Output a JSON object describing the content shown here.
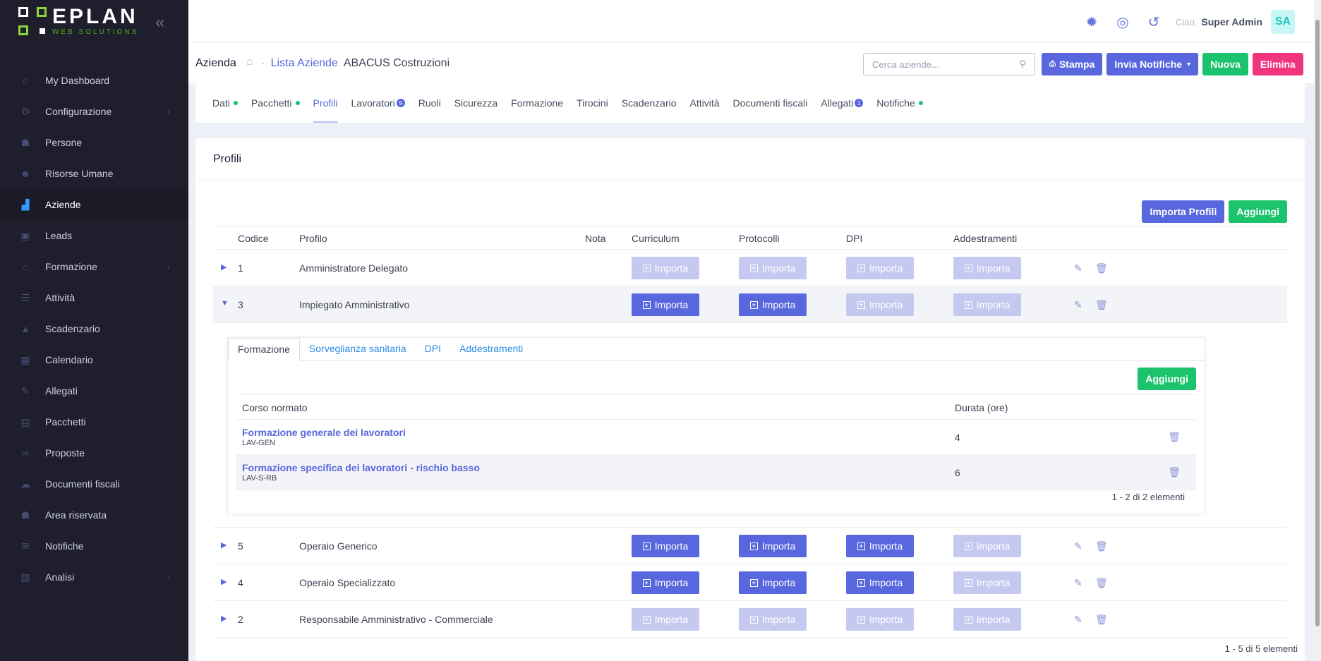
{
  "brand": {
    "name": "EPLAN",
    "tagline": "WEB SOLUTIONS"
  },
  "sidebar": {
    "items": [
      {
        "label": "My Dashboard",
        "icon": "home-icon"
      },
      {
        "label": "Configurazione",
        "icon": "gear-icon",
        "submenu": true
      },
      {
        "label": "Persone",
        "icon": "users-icon"
      },
      {
        "label": "Risorse Umane",
        "icon": "user-icon"
      },
      {
        "label": "Aziende",
        "icon": "factory-icon",
        "active": true
      },
      {
        "label": "Leads",
        "icon": "contact-book-icon"
      },
      {
        "label": "Formazione",
        "icon": "graduation-cap-icon",
        "submenu": true
      },
      {
        "label": "Attività",
        "icon": "list-icon"
      },
      {
        "label": "Scadenzario",
        "icon": "warning-icon"
      },
      {
        "label": "Calendario",
        "icon": "calendar-icon"
      },
      {
        "label": "Allegati",
        "icon": "paperclip-icon"
      },
      {
        "label": "Pacchetti",
        "icon": "package-icon"
      },
      {
        "label": "Proposte",
        "icon": "handshake-icon"
      },
      {
        "label": "Documenti fiscali",
        "icon": "cloud-icon"
      },
      {
        "label": "Area riservata",
        "icon": "user-lock-icon"
      },
      {
        "label": "Notifiche",
        "icon": "envelope-icon"
      },
      {
        "label": "Analisi",
        "icon": "chart-icon",
        "submenu": true
      }
    ]
  },
  "topbar": {
    "greeting": "Ciao,",
    "user": "Super Admin",
    "initials": "SA"
  },
  "subheader": {
    "title": "Azienda",
    "breadcrumb_link": "Lista Aziende",
    "breadcrumb_current": "ABACUS Costruzioni",
    "search_placeholder": "Cerca aziende...",
    "buttons": {
      "print": "Stampa",
      "notify": "Invia Notifiche",
      "new": "Nuova",
      "delete": "Elimina"
    }
  },
  "tabs": [
    {
      "label": "Dati",
      "dot": true
    },
    {
      "label": "Pacchetti",
      "dot": true
    },
    {
      "label": "Profili",
      "active": true
    },
    {
      "label": "Lavoratori",
      "count": "9"
    },
    {
      "label": "Ruoli"
    },
    {
      "label": "Sicurezza"
    },
    {
      "label": "Formazione"
    },
    {
      "label": "Tirocini"
    },
    {
      "label": "Scadenzario"
    },
    {
      "label": "Attività"
    },
    {
      "label": "Documenti fiscali"
    },
    {
      "label": "Allegati",
      "count": "1"
    },
    {
      "label": "Notifiche",
      "dot": true
    }
  ],
  "card": {
    "title": "Profili",
    "import_label": "Importa Profili",
    "add_label": "Aggiungi",
    "columns": {
      "code": "Codice",
      "profile": "Profilo",
      "note": "Nota",
      "cv": "Curriculum",
      "protocols": "Protocolli",
      "dpi": "DPI",
      "training": "Addestramenti"
    },
    "import_btn": "Importa",
    "rows": [
      {
        "code": "1",
        "profile": "Amministratore Delegato",
        "enabled": [
          false,
          false,
          false,
          false
        ]
      },
      {
        "code": "3",
        "profile": "Impiegato Amministrativo",
        "enabled": [
          true,
          true,
          false,
          false
        ],
        "expanded": true
      },
      {
        "code": "5",
        "profile": "Operaio Generico",
        "enabled": [
          true,
          true,
          true,
          false
        ]
      },
      {
        "code": "4",
        "profile": "Operaio Specializzato",
        "enabled": [
          true,
          true,
          true,
          false
        ]
      },
      {
        "code": "2",
        "profile": "Responsabile Amministrativo - Commerciale",
        "enabled": [
          false,
          false,
          false,
          false
        ]
      }
    ],
    "footer": "1 - 5 di 5 elementi"
  },
  "detail": {
    "tabs": [
      "Formazione",
      "Sorveglianza sanitaria",
      "DPI",
      "Addestramenti"
    ],
    "add_label": "Aggiungi",
    "col_course": "Corso normato",
    "col_duration": "Durata (ore)",
    "courses": [
      {
        "name": "Formazione generale dei lavoratori",
        "code": "LAV-GEN",
        "hours": "4"
      },
      {
        "name": "Formazione specifica dei lavoratori - rischio basso",
        "code": "LAV-S-RB",
        "hours": "6"
      }
    ],
    "footer": "1 - 2 di 2 elementi"
  }
}
